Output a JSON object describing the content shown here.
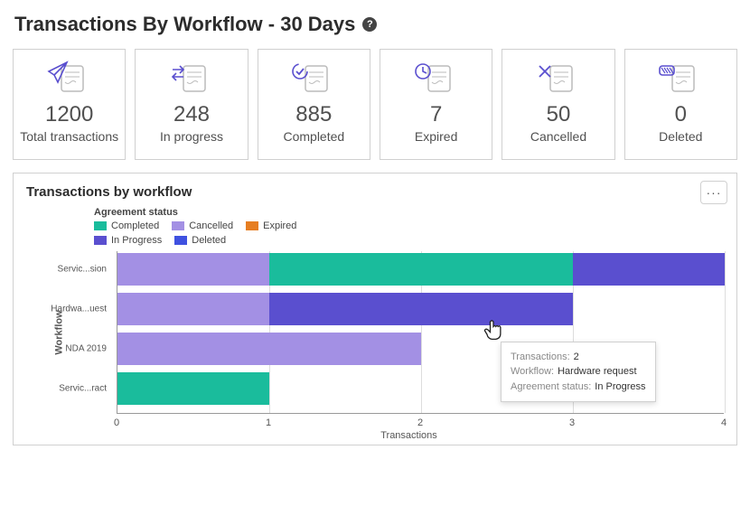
{
  "page_title": "Transactions By Workflow - 30 Days",
  "help_icon": "?",
  "stats": [
    {
      "key": "total",
      "value": "1200",
      "label": "Total transactions"
    },
    {
      "key": "in_progress",
      "value": "248",
      "label": "In progress"
    },
    {
      "key": "completed",
      "value": "885",
      "label": "Completed"
    },
    {
      "key": "expired",
      "value": "7",
      "label": "Expired"
    },
    {
      "key": "cancelled",
      "value": "50",
      "label": "Cancelled"
    },
    {
      "key": "deleted",
      "value": "0",
      "label": "Deleted"
    }
  ],
  "chart_panel": {
    "title": "Transactions by workflow",
    "more_glyph": "···",
    "legend_title": "Agreement status",
    "legend": [
      {
        "name": "Completed",
        "color": "#1abc9c"
      },
      {
        "name": "Cancelled",
        "color": "#a390e4"
      },
      {
        "name": "Expired",
        "color": "#e67e22"
      },
      {
        "name": "In Progress",
        "color": "#5a4fcf"
      },
      {
        "name": "Deleted",
        "color": "#3f51e0"
      }
    ],
    "x_label": "Transactions",
    "y_label": "Workflow",
    "x_ticks": [
      "0",
      "1",
      "2",
      "3",
      "4"
    ]
  },
  "tooltip": {
    "rows": [
      {
        "key": "Transactions:",
        "val": "2"
      },
      {
        "key": "Workflow:",
        "val": "Hardware request"
      },
      {
        "key": "Agreement status:",
        "val": "In Progress"
      }
    ]
  },
  "chart_data": {
    "type": "bar",
    "orientation": "horizontal",
    "stacked": true,
    "xlabel": "Transactions",
    "ylabel": "Workflow",
    "xlim": [
      0,
      4
    ],
    "categories": [
      "Servic...sion",
      "Hardwa...uest",
      "NDA 2019",
      "Servic...ract"
    ],
    "series": [
      {
        "name": "Cancelled",
        "color": "#a390e4",
        "values": [
          1,
          1,
          2,
          0
        ]
      },
      {
        "name": "Completed",
        "color": "#1abc9c",
        "values": [
          2,
          0,
          0,
          1
        ]
      },
      {
        "name": "In Progress",
        "color": "#5a4fcf",
        "values": [
          1,
          2,
          0,
          0
        ]
      },
      {
        "name": "Expired",
        "color": "#e67e22",
        "values": [
          0,
          0,
          0,
          0
        ]
      },
      {
        "name": "Deleted",
        "color": "#3f51e0",
        "values": [
          0,
          0,
          0,
          0
        ]
      }
    ],
    "legend_position": "top-left",
    "grid": true
  }
}
